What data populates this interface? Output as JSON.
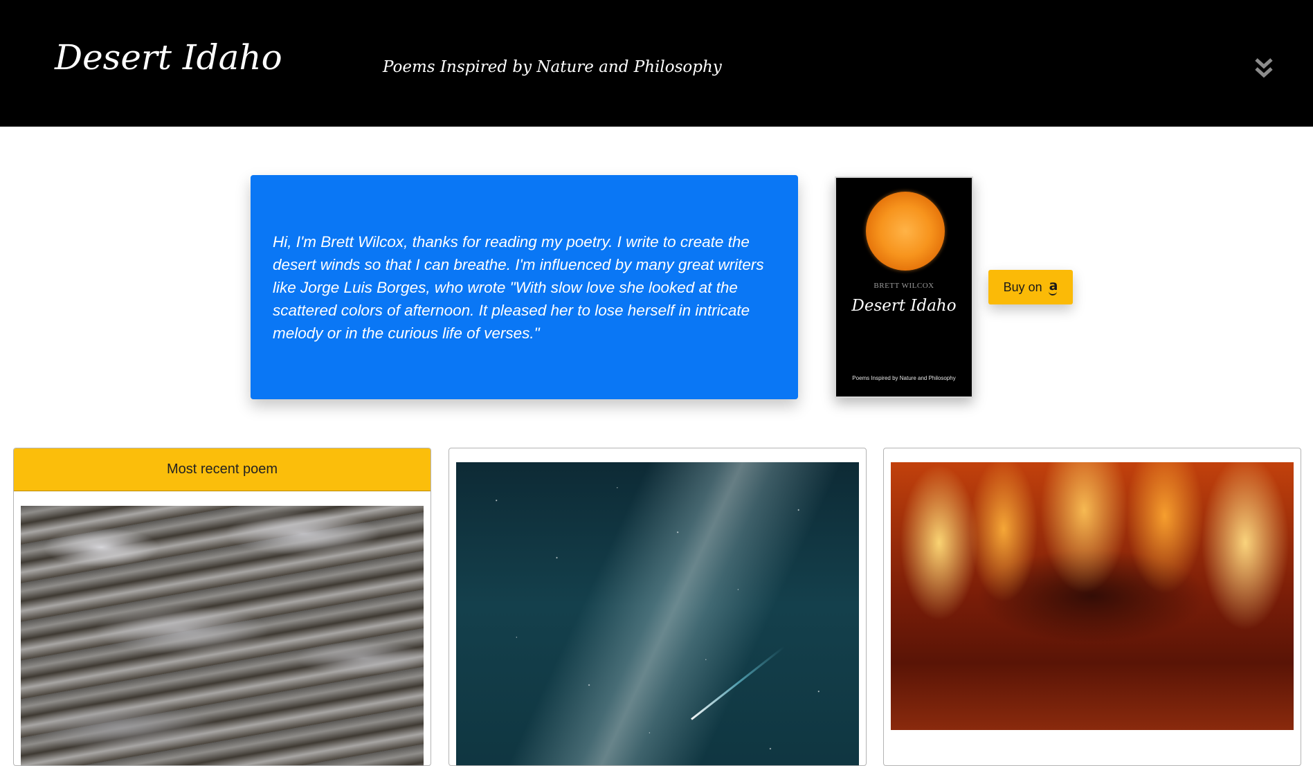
{
  "header": {
    "site_title": "Desert Idaho",
    "tagline": "Poems Inspired by Nature and Philosophy",
    "menu_icon": "double-chevron-down-icon"
  },
  "intro": {
    "text": "Hi, I'm Brett Wilcox, thanks for reading my poetry. I write to create the desert winds so that I can breathe. I'm influenced by many great writers like Jorge Luis Borges, who wrote \"With slow love she looked at the scattered colors of afternoon. It pleased her to lose herself in intricate melody or in the curious life of verses.\""
  },
  "book": {
    "author": "BRETT WILCOX",
    "title": "Desert Idaho",
    "subtitle": "Poems Inspired by Nature and Philosophy",
    "cover_image": "sun-image"
  },
  "buy_button": {
    "label": "Buy on",
    "icon": "amazon-icon",
    "icon_glyph": "a"
  },
  "cards": [
    {
      "header": "Most recent poem",
      "image": "water-image"
    },
    {
      "image": "night-sky-image"
    },
    {
      "image": "fire-image"
    }
  ],
  "colors": {
    "header_bg": "#000000",
    "intro_bg": "#0a77f5",
    "accent_yellow": "#fbbe0b"
  }
}
